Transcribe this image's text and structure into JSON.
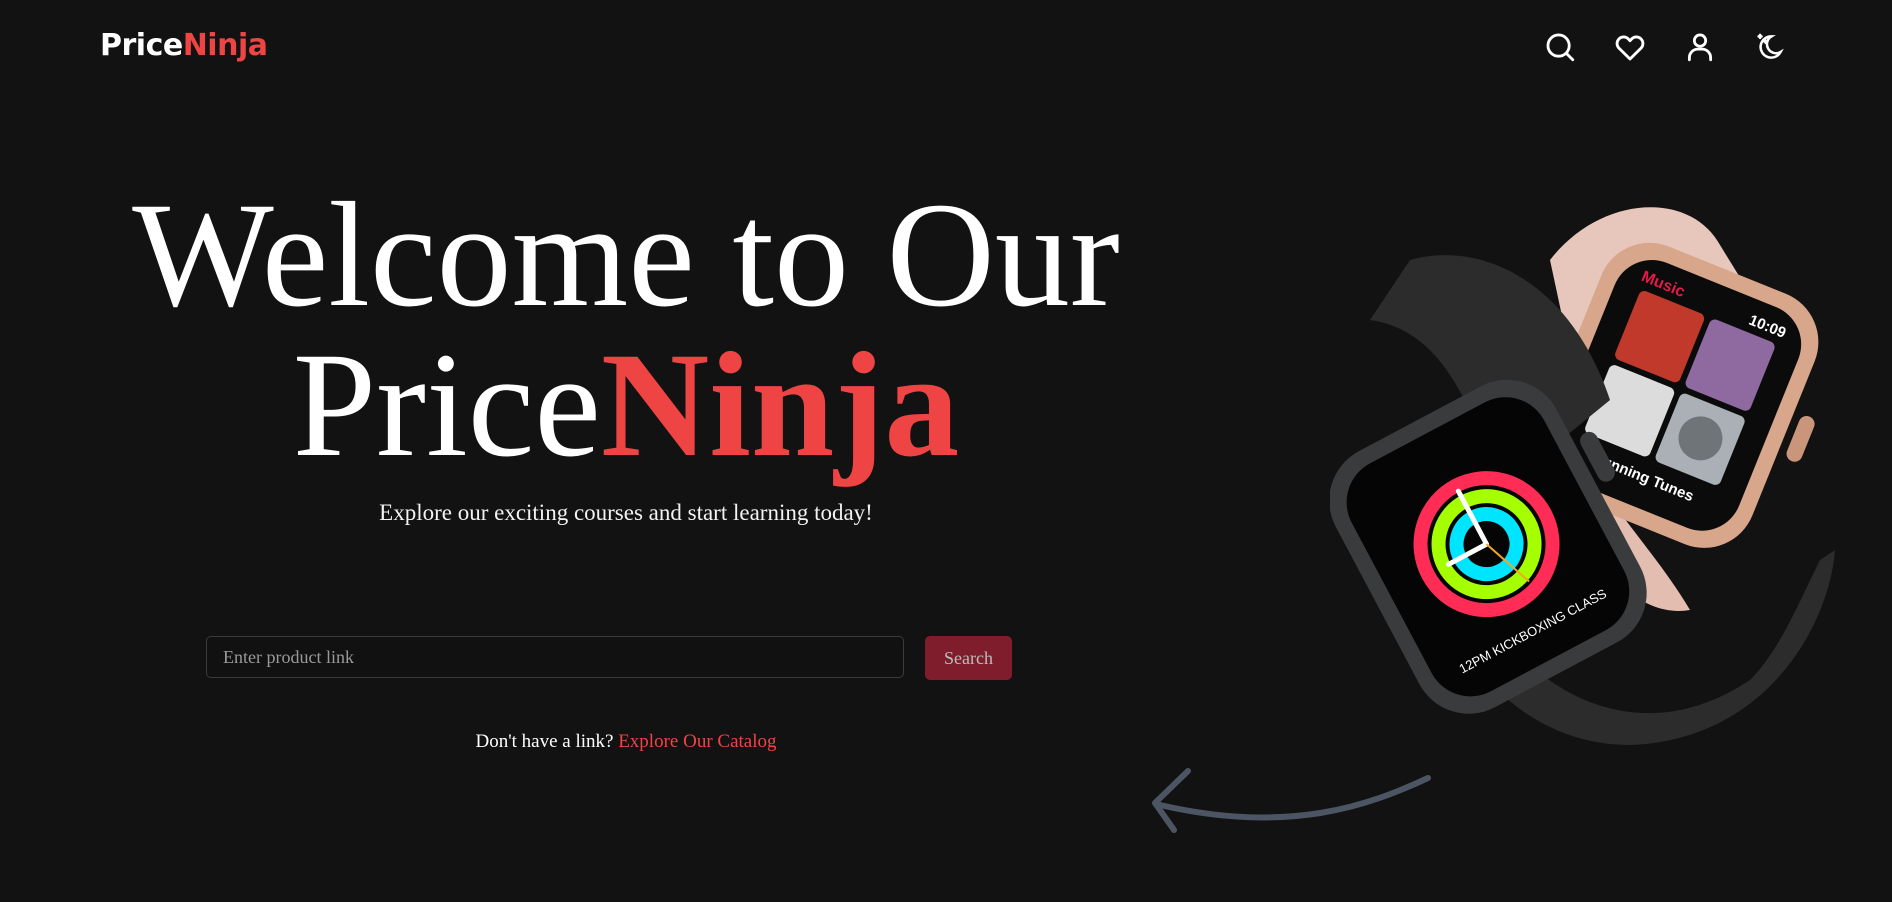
{
  "brand": {
    "part1": "Price",
    "part2": "Ninja"
  },
  "nav": {
    "icons": [
      "search-icon",
      "heart-icon",
      "user-icon",
      "moon-icon"
    ]
  },
  "hero": {
    "title_line1": "Welcome to Our",
    "title_brand1": "Price",
    "title_brand2": "Ninja",
    "subtitle": "Explore our exciting courses and start learning today!"
  },
  "search": {
    "placeholder": "Enter product link",
    "value": "",
    "button_label": "Search"
  },
  "catalog": {
    "prompt": "Don't have a link?",
    "link_label": "Explore Our Catalog"
  },
  "watch_front": {
    "complication": "12PM KICKBOXING CLASS"
  },
  "watch_back": {
    "app": "Music",
    "time": "10:09",
    "playlist": "Running Tunes"
  },
  "colors": {
    "background": "#121212",
    "accent": "#ef4444",
    "button_bg": "#7f1d2d",
    "arrow": "#4b5563"
  }
}
